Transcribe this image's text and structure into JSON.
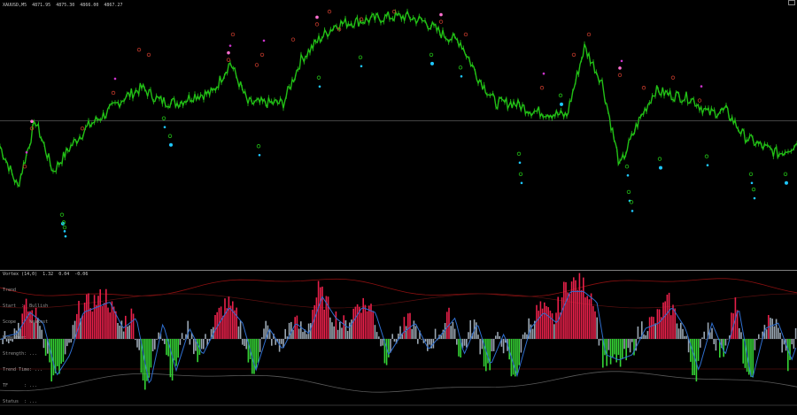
{
  "window": {
    "main_header": "XAUUSD,M5  4871.95  4875.30  4866.00  4867.27",
    "indicator_header": "Vortex (14,0)  1.32  0.04  -0.06",
    "indicator_legend": [
      "Trend",
      "Start  :  Bullish",
      "Scope  :  Weakest",
      "Momentum: ...",
      "Strength: ...",
      "Trend Time: ...",
      "TF      : ...",
      "Status  : ..."
    ]
  },
  "colors": {
    "background": "#000000",
    "price_line": "#22c016",
    "separator": "#808080",
    "hist_bull": "#e8204a",
    "hist_bear": "#35d435",
    "hist_neutral": "#9aa6b2",
    "signal_line": "#2f6fd0",
    "band_upper": "#8b1010",
    "band_lower": "#5a5a5a",
    "marker_pink": "#ff6fd0",
    "marker_magenta": "#cc33cc",
    "marker_cyan": "#1ec8ff",
    "marker_green": "#22c016",
    "marker_red": "#c0392b"
  },
  "chart_data": [
    {
      "type": "line",
      "panel": "main",
      "symbol": "XAUUSD,M5",
      "ohlc": {
        "open": 4871.95,
        "high": 4875.3,
        "low": 4866.0,
        "close": 4867.27
      },
      "x": [
        0,
        20,
        40,
        60,
        80,
        100,
        120,
        140,
        160,
        180,
        200,
        220,
        240,
        260,
        280,
        300,
        320,
        340,
        360,
        380,
        400,
        420,
        440,
        460,
        480,
        500,
        520,
        540,
        560,
        580,
        600,
        620,
        640,
        660,
        680,
        700,
        720,
        740,
        760,
        780,
        800,
        820,
        840,
        860,
        880,
        900
      ],
      "y": [
        48,
        32,
        58,
        38,
        48,
        56,
        61,
        67,
        71,
        66,
        65,
        68,
        69,
        81,
        65,
        65,
        65,
        82,
        90,
        96,
        97,
        98,
        99,
        99,
        97,
        92,
        89,
        75,
        65,
        65,
        62,
        61,
        60,
        87,
        73,
        40,
        57,
        70,
        68,
        67,
        61,
        62,
        52,
        48,
        45,
        49
      ],
      "hline": 58,
      "markers_up": [
        [
          28,
          40
        ],
        [
          36,
          55
        ],
        [
          93,
          55
        ],
        [
          128,
          69
        ],
        [
          157,
          86
        ],
        [
          168,
          84
        ],
        [
          258,
          82
        ],
        [
          263,
          92
        ],
        [
          290,
          80
        ],
        [
          296,
          84
        ],
        [
          331,
          90
        ],
        [
          358,
          96
        ],
        [
          372,
          101
        ],
        [
          383,
          94
        ],
        [
          408,
          98
        ],
        [
          445,
          101
        ],
        [
          498,
          97
        ],
        [
          526,
          92
        ],
        [
          612,
          71
        ],
        [
          648,
          84
        ],
        [
          665,
          92
        ],
        [
          700,
          76
        ],
        [
          727,
          71
        ],
        [
          760,
          75
        ],
        [
          790,
          66
        ]
      ],
      "markers_down": [
        [
          70,
          21
        ],
        [
          72,
          18
        ],
        [
          73,
          16
        ],
        [
          185,
          59
        ],
        [
          192,
          52
        ],
        [
          292,
          48
        ],
        [
          360,
          75
        ],
        [
          407,
          83
        ],
        [
          487,
          84
        ],
        [
          520,
          79
        ],
        [
          586,
          45
        ],
        [
          588,
          37
        ],
        [
          633,
          68
        ],
        [
          708,
          40
        ],
        [
          710,
          30
        ],
        [
          713,
          26
        ],
        [
          745,
          43
        ],
        [
          798,
          44
        ],
        [
          848,
          37
        ],
        [
          851,
          31
        ],
        [
          887,
          37
        ]
      ]
    },
    {
      "type": "bar",
      "panel": "indicator",
      "title": "Vortex (14,0)",
      "values": [
        1.32,
        0.04,
        -0.06
      ],
      "ylim": [
        -1,
        1
      ],
      "series": [
        {
          "name": "histogram",
          "x": [
            0,
            15,
            30,
            45,
            60,
            75,
            90,
            105,
            120,
            135,
            150,
            165,
            180,
            195,
            210,
            225,
            240,
            255,
            270,
            285,
            300,
            315,
            330,
            345,
            360,
            375,
            390,
            405,
            420,
            435,
            450,
            465,
            480,
            495,
            510,
            520,
            535,
            550,
            565,
            580,
            595,
            610,
            625,
            640,
            655,
            670,
            680,
            695,
            710,
            725,
            740,
            755,
            770,
            785,
            800,
            815,
            830,
            845,
            860,
            875,
            890,
            900
          ],
          "y": [
            0.04,
            0.1,
            0.5,
            0.3,
            -0.7,
            -0.3,
            0.5,
            0.6,
            0.7,
            0.2,
            0.4,
            -0.9,
            0.3,
            -0.6,
            0.2,
            -0.3,
            0.2,
            0.6,
            0.3,
            -0.6,
            0.2,
            -0.2,
            0.3,
            0.1,
            0.8,
            0.4,
            0.2,
            0.6,
            0.5,
            -0.3,
            0.1,
            0.3,
            -0.2,
            0.1,
            0.4,
            -0.3,
            0.3,
            -0.5,
            0.1,
            -0.7,
            0.2,
            0.5,
            0.3,
            0.9,
            0.9,
            0.7,
            -0.3,
            -0.4,
            -0.3,
            0.2,
            0.3,
            0.6,
            0.2,
            -0.6,
            0.3,
            -0.3,
            0.6,
            -0.8,
            0.2,
            0.3,
            -0.4,
            0.1
          ]
        }
      ]
    }
  ]
}
